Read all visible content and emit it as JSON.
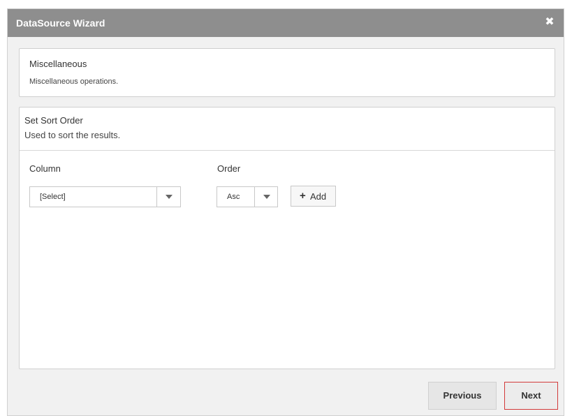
{
  "dialog": {
    "title": "DataSource Wizard",
    "close_icon": "close-icon"
  },
  "misc_panel": {
    "title": "Miscellaneous",
    "description": "Miscellaneous operations."
  },
  "sort_panel": {
    "title": "Set Sort Order",
    "description": "Used to sort the results.",
    "column_label": "Column",
    "order_label": "Order",
    "column_select_value": "[Select]",
    "order_select_value": "Asc",
    "add_button_label": "Add"
  },
  "footer": {
    "previous_label": "Previous",
    "next_label": "Next"
  },
  "colors": {
    "titlebar": "#8e8e8e",
    "next_border": "#d23a3a"
  }
}
